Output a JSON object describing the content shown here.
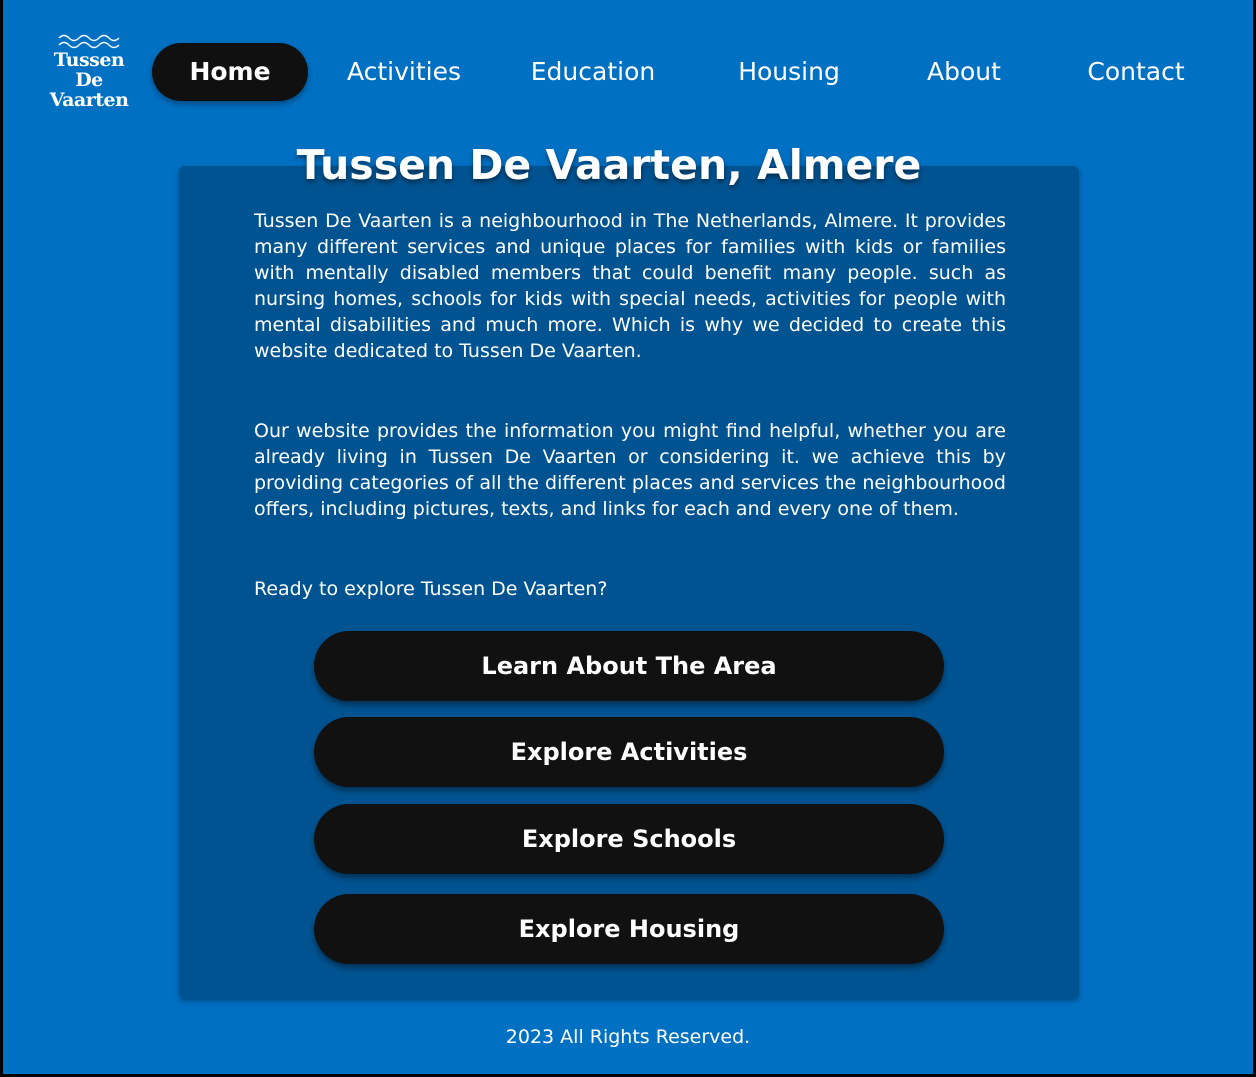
{
  "logo": {
    "line1": "Tussen De",
    "line2": "Vaarten"
  },
  "nav": {
    "items": [
      {
        "label": "Home",
        "active": true
      },
      {
        "label": "Activities"
      },
      {
        "label": "Education"
      },
      {
        "label": "Housing"
      },
      {
        "label": "About"
      },
      {
        "label": "Contact"
      }
    ]
  },
  "main": {
    "title": "Tussen De Vaarten, Almere",
    "paragraphs": [
      "Tussen De Vaarten is a neighbourhood in The Netherlands, Almere. It provides many different services and unique places for families with kids or families with mentally disabled members that could benefit many people. such as nursing homes, schools for kids with special needs, activities for people with mental disabilities and much more. Which is why we decided to create this website dedicated to Tussen De Vaarten.",
      "Our website provides the information you might find helpful, whether you are already living in Tussen De Vaarten or considering it. we achieve this by providing categories of all the different places and services the neighbourhood offers, including pictures, texts, and links for each and every one of them.",
      "Ready to explore Tussen De Vaarten?"
    ],
    "buttons": [
      {
        "label": "Learn About The Area"
      },
      {
        "label": "Explore Activities"
      },
      {
        "label": "Explore Schools"
      },
      {
        "label": "Explore Housing"
      }
    ]
  },
  "footer": {
    "text": "2023 All Rights Reserved."
  },
  "colors": {
    "page_bg": "#0070c3",
    "card_bg": "#005391",
    "button_bg": "#111111",
    "text": "#ffffff"
  }
}
